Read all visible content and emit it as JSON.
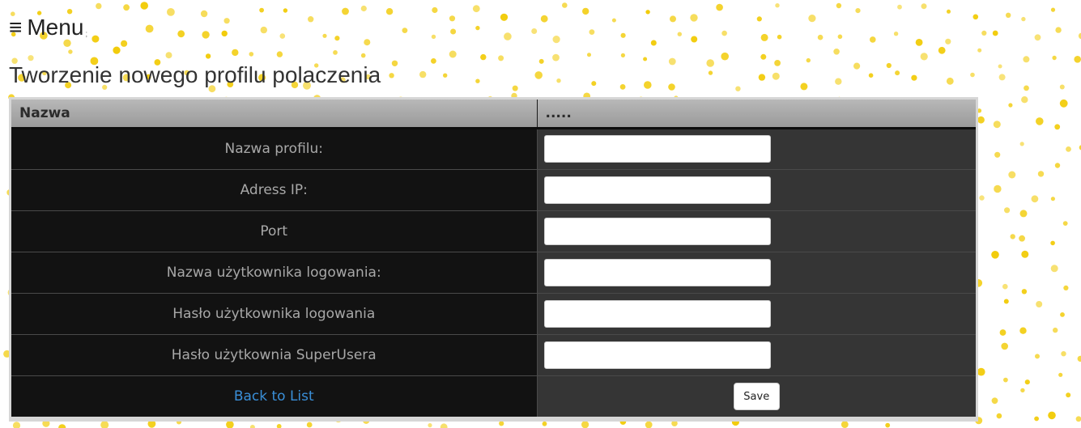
{
  "header": {
    "menu_icon": "≡",
    "menu_label": "Menu",
    "menu_suffix": ";"
  },
  "page_title": "Tworzenie nowego profilu polaczenia",
  "table": {
    "headers": [
      "Nazwa",
      "....."
    ],
    "rows": [
      {
        "label": "Nazwa profilu:",
        "value": "",
        "placeholder": ""
      },
      {
        "label": "Adress IP:",
        "value": "",
        "placeholder": ""
      },
      {
        "label": "Port",
        "value": "",
        "placeholder": ""
      },
      {
        "label": "Nazwa użytkownika logowania:",
        "value": "",
        "placeholder": ""
      },
      {
        "label": "Hasło użytkownika logowania",
        "value": "",
        "placeholder": ""
      },
      {
        "label": "Hasło użytkownia SuperUsera",
        "value": "",
        "placeholder": ""
      }
    ],
    "back_link": "Back to List",
    "save_label": "Save"
  },
  "colors": {
    "dot": "#f2cc0c",
    "link": "#3a8fd8",
    "label_bg": "#121212",
    "input_bg": "#353535"
  }
}
